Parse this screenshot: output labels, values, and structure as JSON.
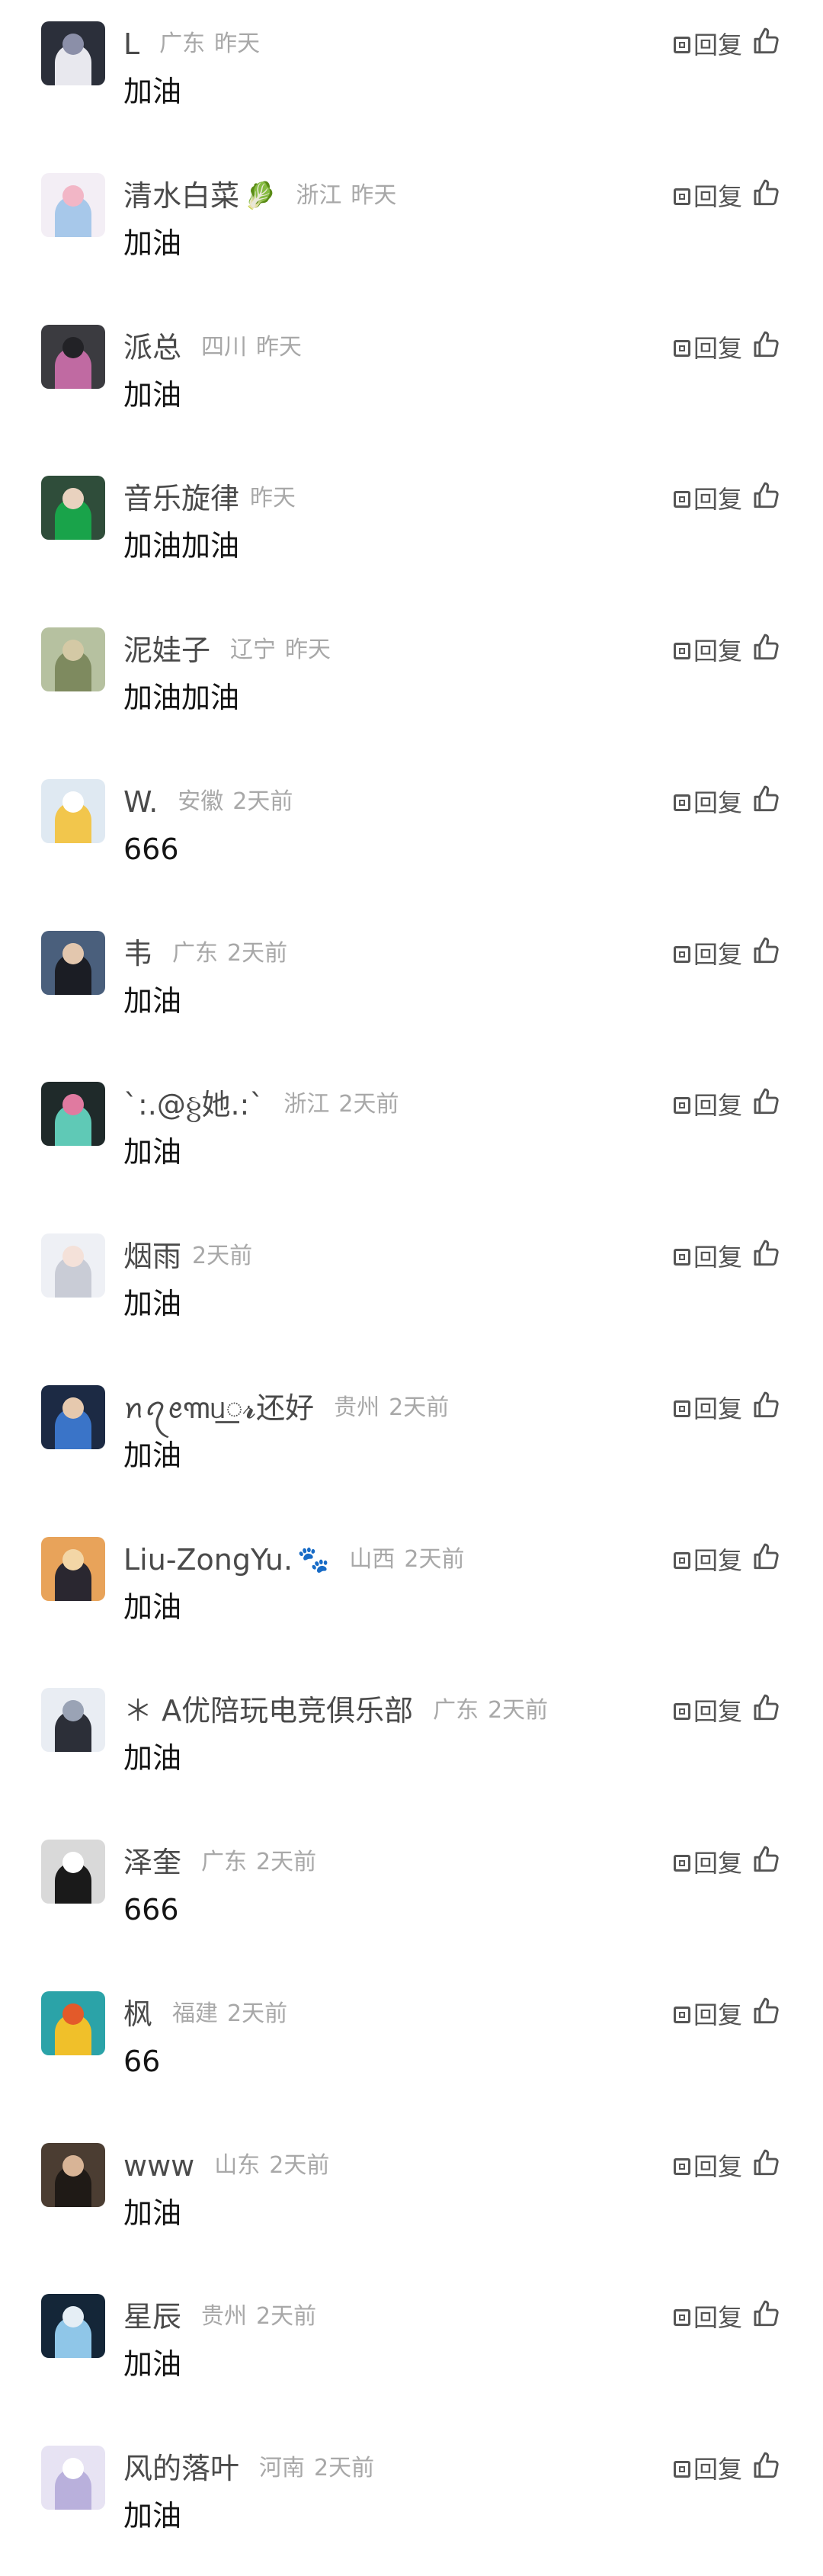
{
  "reply_label": "回复",
  "comments": [
    {
      "nickname": "L",
      "emoji": "",
      "region": "广东",
      "time": "昨天",
      "text": "加油",
      "avatar": {
        "bg": "#2b2f3a",
        "fg": "#e8e8ee",
        "fg2": "#8b8fa8"
      }
    },
    {
      "nickname": "清水白菜",
      "emoji": "🥬",
      "region": "浙江",
      "time": "昨天",
      "text": "加油",
      "avatar": {
        "bg": "#f3eef5",
        "fg": "#a7c8ea",
        "fg2": "#f2b6c6"
      }
    },
    {
      "nickname": "派总",
      "emoji": "",
      "region": "四川",
      "time": "昨天",
      "text": "加油",
      "avatar": {
        "bg": "#3b3b40",
        "fg": "#c06aa2",
        "fg2": "#222226"
      }
    },
    {
      "nickname": "音乐旋律",
      "emoji": "",
      "region": "",
      "time": "昨天",
      "text": "加油加油",
      "avatar": {
        "bg": "#2f4d3a",
        "fg": "#19a34a",
        "fg2": "#e9d2bf"
      }
    },
    {
      "nickname": "泥娃子",
      "emoji": "",
      "region": "辽宁",
      "time": "昨天",
      "text": "加油加油",
      "avatar": {
        "bg": "#b6c1a0",
        "fg": "#7e8a5f",
        "fg2": "#d4c9a5"
      }
    },
    {
      "nickname": "W.",
      "emoji": "",
      "region": "安徽",
      "time": "2天前",
      "text": "666",
      "avatar": {
        "bg": "#dfe9f2",
        "fg": "#f2c64c",
        "fg2": "#ffffff"
      }
    },
    {
      "nickname": "韦",
      "emoji": "",
      "region": "广东",
      "time": "2天前",
      "text": "加油",
      "avatar": {
        "bg": "#4a5f7c",
        "fg": "#1b1d24",
        "fg2": "#e3c7ae"
      }
    },
    {
      "nickname": "`:.@ઠ્ઠ她.:`",
      "emoji": "",
      "region": "浙江",
      "time": "2天前",
      "text": "加油",
      "avatar": {
        "bg": "#1f2a2a",
        "fg": "#5fc9b6",
        "fg2": "#e07aa0"
      }
    },
    {
      "nickname": "烟雨",
      "emoji": "",
      "region": "",
      "time": "2天前",
      "text": "加油",
      "avatar": {
        "bg": "#eef0f5",
        "fg": "#c9ccd6",
        "fg2": "#f4e1d9"
      }
    },
    {
      "nickname": "ꪀꪖꫀ꧑ᥙ꯭𝓻还好",
      "emoji": "",
      "region": "贵州",
      "time": "2天前",
      "text": "加油",
      "avatar": {
        "bg": "#1c2a44",
        "fg": "#3a74c8",
        "fg2": "#e6c9ae"
      }
    },
    {
      "nickname": "Liu-ZongYu.",
      "emoji": "🐾",
      "region": "山西",
      "time": "2天前",
      "text": "加油",
      "avatar": {
        "bg": "#e8a35a",
        "fg": "#2a2730",
        "fg2": "#f3d6a6"
      }
    },
    {
      "nickname": "＊ A优陪玩电竞俱乐部",
      "emoji": "",
      "region": "广东",
      "time": "2天前",
      "text": "加油",
      "avatar": {
        "bg": "#e9edf3",
        "fg": "#2c2f38",
        "fg2": "#9aa3b5"
      }
    },
    {
      "nickname": "泽奎",
      "emoji": "",
      "region": "广东",
      "time": "2天前",
      "text": "666",
      "avatar": {
        "bg": "#d9d9d9",
        "fg": "#1a1a1a",
        "fg2": "#ffffff"
      }
    },
    {
      "nickname": "枫",
      "emoji": "",
      "region": "福建",
      "time": "2天前",
      "text": "66",
      "avatar": {
        "bg": "#2ba3a8",
        "fg": "#f0c02a",
        "fg2": "#e35a2a"
      }
    },
    {
      "nickname": "www",
      "emoji": "",
      "region": "山东",
      "time": "2天前",
      "text": "加油",
      "avatar": {
        "bg": "#4b3d32",
        "fg": "#1f1a16",
        "fg2": "#d8b496"
      }
    },
    {
      "nickname": "星辰",
      "emoji": "",
      "region": "贵州",
      "time": "2天前",
      "text": "加油",
      "avatar": {
        "bg": "#142638",
        "fg": "#8fc6e8",
        "fg2": "#e5eef5"
      }
    },
    {
      "nickname": "风的落叶",
      "emoji": "",
      "region": "河南",
      "time": "2天前",
      "text": "加油",
      "avatar": {
        "bg": "#e7e3f3",
        "fg": "#b9b0dc",
        "fg2": "#ffffff"
      }
    }
  ]
}
